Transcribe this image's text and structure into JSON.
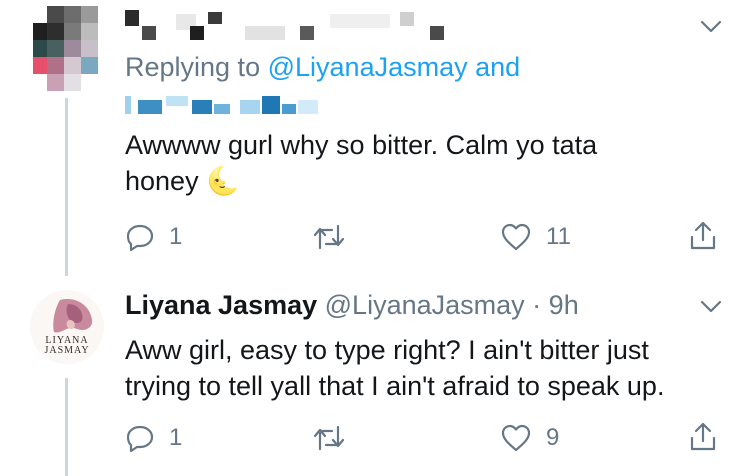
{
  "tweet1": {
    "replying_prefix": "Replying to",
    "replying_mention": "@LiyanaJasmay",
    "replying_suffix": "and",
    "text_line1": "Awwww gurl why so bitter. Calm yo tata",
    "text_line2": "honey",
    "emoji": "🌜",
    "actions": {
      "reply_count": "1",
      "like_count": "11"
    }
  },
  "tweet2": {
    "display_name": "Liyana Jasmay",
    "handle": "@LiyanaJasmay",
    "separator": "·",
    "time": "9h",
    "avatar_text_line1": "LIYANA",
    "avatar_text_line2": "JASMAY",
    "text_line1": "Aww girl, easy to type right? I ain't bitter just",
    "text_line2": "trying to tell yall that I ain't afraid to speak up.",
    "actions": {
      "reply_count": "1",
      "like_count": "9"
    }
  },
  "colors": {
    "accent": "#1da1f2",
    "secondary_text": "#657786",
    "primary_text": "#14171a",
    "thread_line": "#ccd6dd"
  },
  "icons": [
    "reply-icon",
    "retweet-icon",
    "like-icon",
    "share-icon",
    "chevron-down-icon"
  ]
}
